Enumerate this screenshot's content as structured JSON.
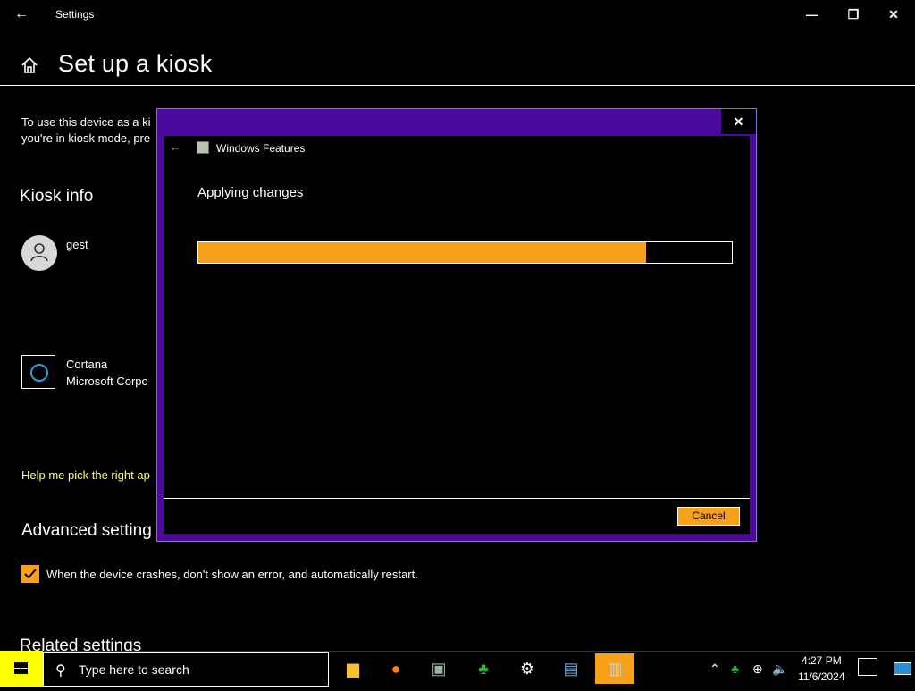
{
  "window": {
    "back_glyph": "←",
    "title": "Settings",
    "minimize": "—",
    "maximize": "❐",
    "close": "✕"
  },
  "page": {
    "title": "Set up a kiosk",
    "description_line1": "To use this device as a ki",
    "description_line2": "you're in kiosk mode, pre",
    "kiosk_info_heading": "Kiosk info",
    "account_name": "gest",
    "app_name": "Cortana",
    "app_publisher": "Microsoft Corpo",
    "help_link": "Help me pick the right ap",
    "advanced_heading": "Advanced setting",
    "crash_checkbox_label": "When the device crashes, don't show an error, and automatically restart.",
    "crash_checkbox_checked": true,
    "related_heading": "Related settings"
  },
  "dialog": {
    "close": "✕",
    "back_glyph": "←",
    "title": "Windows Features",
    "status": "Applying changes",
    "progress": 0.84,
    "cancel_label": "Cancel"
  },
  "taskbar": {
    "search_placeholder": "Type here to search",
    "apps": [
      "file-explorer",
      "firefox",
      "windows-features",
      "people",
      "settings",
      "control-panel",
      "windows-features-dialog"
    ],
    "active_app": "windows-features-dialog",
    "time": "4:27 PM",
    "date": "11/6/2024"
  },
  "colors": {
    "accent": "#f7a11a",
    "dialog_frame": "#4b0a9c",
    "link": "#ffff66",
    "start": "#ffff00"
  }
}
